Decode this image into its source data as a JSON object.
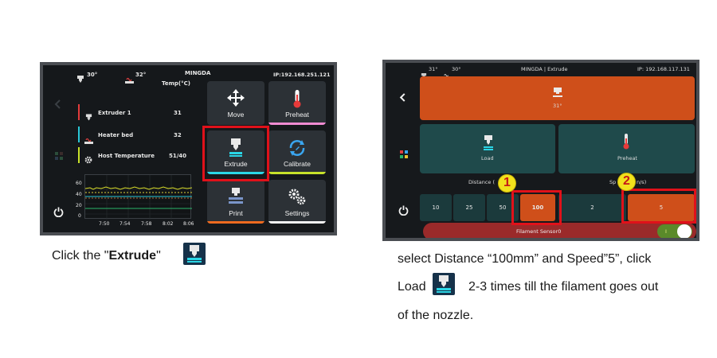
{
  "screen1": {
    "status": {
      "nozzle_temp": "30°",
      "bed_temp": "32°",
      "brand": "MINGDA",
      "ip": "IP:192.168.251.121"
    },
    "temp_header": "Temp(°C)",
    "temp_rows": [
      {
        "label": "Extruder 1",
        "value": "31",
        "accent": "#e23b3b"
      },
      {
        "label": "Heater bed",
        "value": "32",
        "accent": "#29c7d6"
      },
      {
        "label": "Host Temperature",
        "value": "51/40",
        "accent": "#c8e22a"
      }
    ],
    "graph": {
      "y_ticks": [
        "60",
        "40",
        "20",
        "0"
      ],
      "x_ticks": [
        "7:50",
        "7:54",
        "7:58",
        "8:02",
        "8:06"
      ]
    },
    "tiles": [
      {
        "label": "Move",
        "icon": "move-arrows-icon",
        "accent": "#2c3136"
      },
      {
        "label": "Preheat",
        "icon": "thermometer-icon",
        "accent": "#f08bd2"
      },
      {
        "label": "Extrude",
        "icon": "extruder-icon",
        "accent": "#2ad6e6"
      },
      {
        "label": "Calibrate",
        "icon": "calibrate-icon",
        "accent": "#c8e22a"
      },
      {
        "label": "Print",
        "icon": "print-icon",
        "accent": "#ee6a1f"
      },
      {
        "label": "Settings",
        "icon": "gears-icon",
        "accent": "#f2f2f2"
      }
    ],
    "highlight_color": "#e0111a"
  },
  "caption1": {
    "prefix": "Click the \"",
    "bold": "Extrude",
    "suffix": "\""
  },
  "screen2": {
    "status": {
      "nozzle_temp": "31°",
      "bed_temp": "30°",
      "title": "MINGDA | Extrude",
      "ip": "IP: 192.168.117.131"
    },
    "top_card_temp": "31°",
    "load_label": "Load",
    "preheat_label": "Preheat",
    "distance_label": "Distance (",
    "speed_label_left": "Sp",
    "speed_label_right": "n/s)",
    "distance_options": [
      "10",
      "25",
      "50",
      "100"
    ],
    "speed_options": [
      "2",
      "5"
    ],
    "filament_sensor_label": "Filament Sensor0",
    "toggle_text": "I",
    "accent_orange": "#cf4f1a",
    "badge_1": "1",
    "badge_2": "2"
  },
  "caption2": {
    "line1": "select Distance “100mm” and Speed”5”, click",
    "line2_prefix": "Load",
    "line2_suffix": "2-3 times till the filament goes out",
    "line3": "of the nozzle."
  }
}
